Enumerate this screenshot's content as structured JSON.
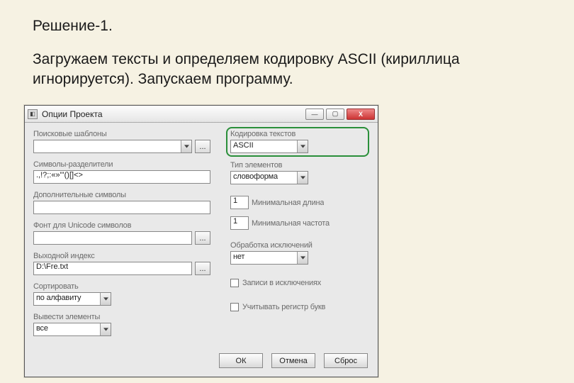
{
  "doc": {
    "heading": "Решение-1.",
    "body": "Загружаем тексты и определяем кодировку ASCII (кириллица игнорируется). Запускаем программу."
  },
  "window": {
    "title": "Опции Проекта",
    "minimize_glyph": "—",
    "maximize_glyph": "▢",
    "close_glyph": "X",
    "browse_label": "...",
    "left": {
      "search_templates_label": "Поисковые шаблоны",
      "search_templates_value": "",
      "separators_label": "Символы-разделители",
      "separators_value": ".,!?;:«»\"'()[]<>",
      "additional_label": "Дополнительные символы",
      "additional_value": "",
      "font_label": "Фонт для Unicode символов",
      "font_value": "",
      "out_index_label": "Выходной индекс",
      "out_index_value": "D:\\Fre.txt",
      "sort_label": "Сортировать",
      "sort_value": "по алфавиту",
      "output_label": "Вывести элементы",
      "output_value": "все"
    },
    "right": {
      "encoding_label": "Кодировка текстов",
      "encoding_value": "ASCII",
      "element_type_label": "Тип элементов",
      "element_type_value": "словоформа",
      "min_len_label": "Минимальная длина",
      "min_len_value": "1",
      "min_freq_label": "Минимальная частота",
      "min_freq_value": "1",
      "exclusions_label": "Обработка исключений",
      "exclusions_value": "нет",
      "cb_hits_label": "Записи в исключениях",
      "cb_case_label": "Учитывать регистр букв"
    },
    "buttons": {
      "ok": "ОК",
      "cancel": "Отмена",
      "reset": "Сброс"
    }
  }
}
